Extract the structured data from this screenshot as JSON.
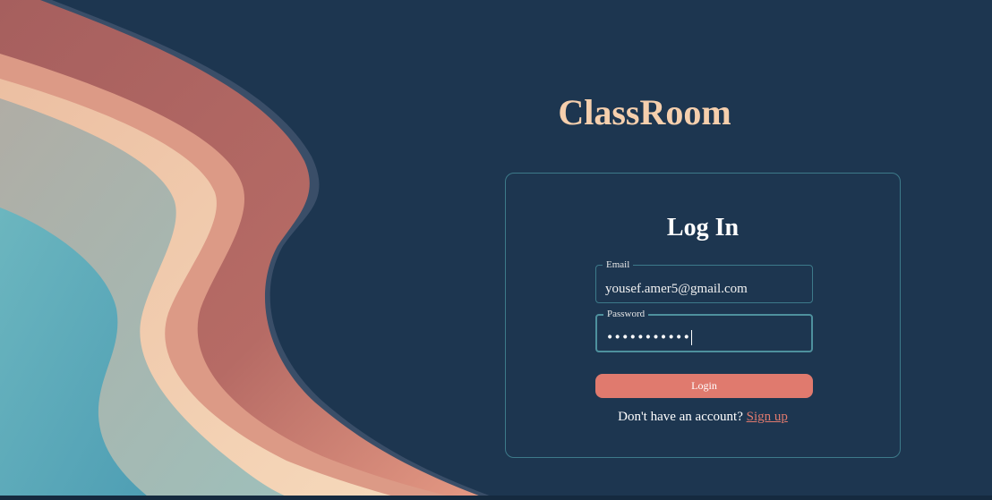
{
  "app": {
    "title": "ClassRoom"
  },
  "login_card": {
    "heading": "Log In",
    "email": {
      "label": "Email",
      "value": "yousef.amer5@gmail.com"
    },
    "password": {
      "label": "Password",
      "masked_value": "•••••••••••",
      "focused": true
    },
    "login_button_label": "Login",
    "signup_prompt": "Don't have an account?",
    "signup_link_label": "Sign up"
  },
  "colors": {
    "background": "#1d3650",
    "title": "#f5cfad",
    "accent": "#e07a6e",
    "border": "#3d7a8a",
    "wave_teal": "#64b1ba",
    "wave_peach": "#f4c9a6",
    "wave_coral": "#d68577",
    "wave_maroon": "#a8625f"
  }
}
